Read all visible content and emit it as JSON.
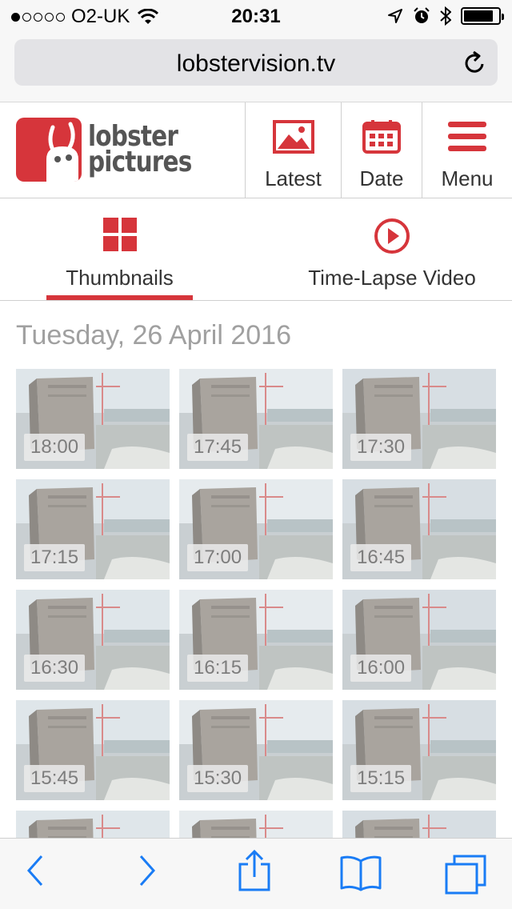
{
  "status_bar": {
    "carrier": "O2-UK",
    "time": "20:31",
    "battery_level": 0.85,
    "icons": [
      "signal-dots-icon",
      "wifi-icon",
      "location-icon",
      "alarm-icon",
      "bluetooth-icon",
      "battery-icon"
    ]
  },
  "browser": {
    "url": "lobstervision.tv"
  },
  "header": {
    "logo_line1": "lobster",
    "logo_line2": "pictures",
    "nav": [
      {
        "label": "Latest",
        "icon": "image-icon"
      },
      {
        "label": "Date",
        "icon": "calendar-icon"
      },
      {
        "label": "Menu",
        "icon": "hamburger-icon"
      }
    ]
  },
  "tabs": [
    {
      "label": "Thumbnails",
      "icon": "grid-icon",
      "active": true
    },
    {
      "label": "Time-Lapse Video",
      "icon": "play-icon",
      "active": false
    }
  ],
  "content": {
    "date_heading": "Tuesday, 26 April 2016",
    "thumbnails": [
      "18:00",
      "17:45",
      "17:30",
      "17:15",
      "17:00",
      "16:45",
      "16:30",
      "16:15",
      "16:00",
      "15:45",
      "15:30",
      "15:15",
      "",
      "",
      ""
    ]
  },
  "colors": {
    "brand_red": "#d6353b",
    "toolbar_blue": "#1a7cf5"
  }
}
